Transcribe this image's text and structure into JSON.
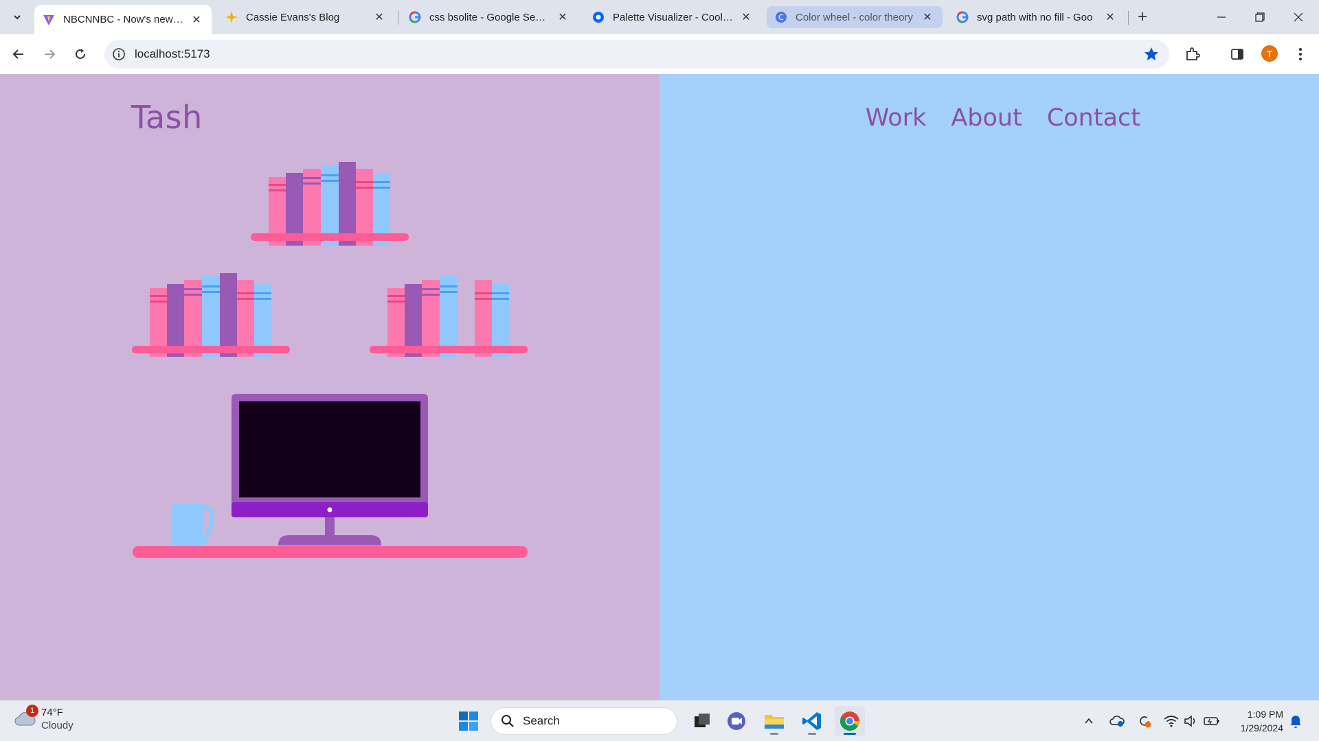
{
  "browser": {
    "tabs": [
      {
        "title": "NBCNNBC - Now's news: n",
        "icon": "vite-icon"
      },
      {
        "title": "Cassie Evans's Blog",
        "icon": "sparkle-icon"
      },
      {
        "title": "css bsolite - Google Search",
        "icon": "google-icon"
      },
      {
        "title": "Palette Visualizer - Coolors",
        "icon": "coolors-icon"
      },
      {
        "title": "Color wheel - color theory",
        "icon": "canva-icon"
      },
      {
        "title": "svg path with no fill - Goo",
        "icon": "google-icon"
      }
    ],
    "url": "localhost:5173",
    "profile_initial": "T"
  },
  "page": {
    "brand": "Tash",
    "nav": {
      "work": "Work",
      "about": "About",
      "contact": "Contact"
    },
    "colors": {
      "left_bg": "#ceb4d9",
      "right_bg": "#a4d1fc",
      "accent_text": "#8b4fa7",
      "pink": "#fe78b0",
      "purple": "#9b59b6",
      "blue": "#8ec8fd",
      "shelf": "#fd5c97",
      "screen": "#12001a"
    }
  },
  "taskbar": {
    "weather": {
      "temp": "74°F",
      "condition": "Cloudy",
      "badge": "1"
    },
    "search_placeholder": "Search",
    "time": "1:09 PM",
    "date": "1/29/2024"
  }
}
